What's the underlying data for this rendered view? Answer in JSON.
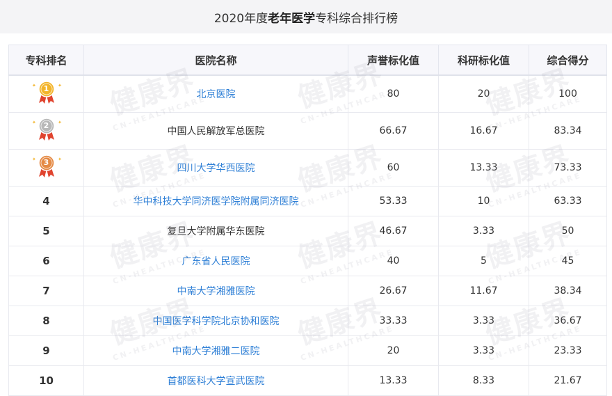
{
  "page": {
    "title_year": "2020年度",
    "title_bold": "老年医学",
    "title_rest": "专科综合排行榜"
  },
  "table": {
    "headers": [
      "专科排名",
      "医院名称",
      "声誉标化值",
      "科研标化值",
      "综合得分"
    ],
    "rows": [
      {
        "rank": "1",
        "hospital": "北京医院",
        "reputation": "80",
        "research": "20",
        "score": "100"
      },
      {
        "rank": "2",
        "hospital": "中国人民解放军总医院",
        "reputation": "66.67",
        "research": "16.67",
        "score": "83.34"
      },
      {
        "rank": "3",
        "hospital": "四川大学华西医院",
        "reputation": "60",
        "research": "13.33",
        "score": "73.33"
      },
      {
        "rank": "4",
        "hospital": "华中科技大学同济医学院附属同济医院",
        "reputation": "53.33",
        "research": "10",
        "score": "63.33"
      },
      {
        "rank": "5",
        "hospital": "复旦大学附属华东医院",
        "reputation": "46.67",
        "research": "3.33",
        "score": "50"
      },
      {
        "rank": "6",
        "hospital": "广东省人民医院",
        "reputation": "40",
        "research": "5",
        "score": "45"
      },
      {
        "rank": "7",
        "hospital": "中南大学湘雅医院",
        "reputation": "26.67",
        "research": "11.67",
        "score": "38.34"
      },
      {
        "rank": "8",
        "hospital": "中国医学科学院北京协和医院",
        "reputation": "33.33",
        "research": "3.33",
        "score": "36.67"
      },
      {
        "rank": "9",
        "hospital": "中南大学湘雅二医院",
        "reputation": "20",
        "research": "3.33",
        "score": "23.33"
      },
      {
        "rank": "10",
        "hospital": "首都医科大学宣武医院",
        "reputation": "13.33",
        "research": "8.33",
        "score": "21.67"
      }
    ]
  },
  "watermark": {
    "main": "健康界",
    "sub": "CN-HEALTHCARE"
  },
  "colors": {
    "link": "#2e7fd6",
    "gold": "#f2b42a",
    "silver": "#b8b8b8",
    "bronze": "#e58a45",
    "ribbon": "#e0442f"
  }
}
